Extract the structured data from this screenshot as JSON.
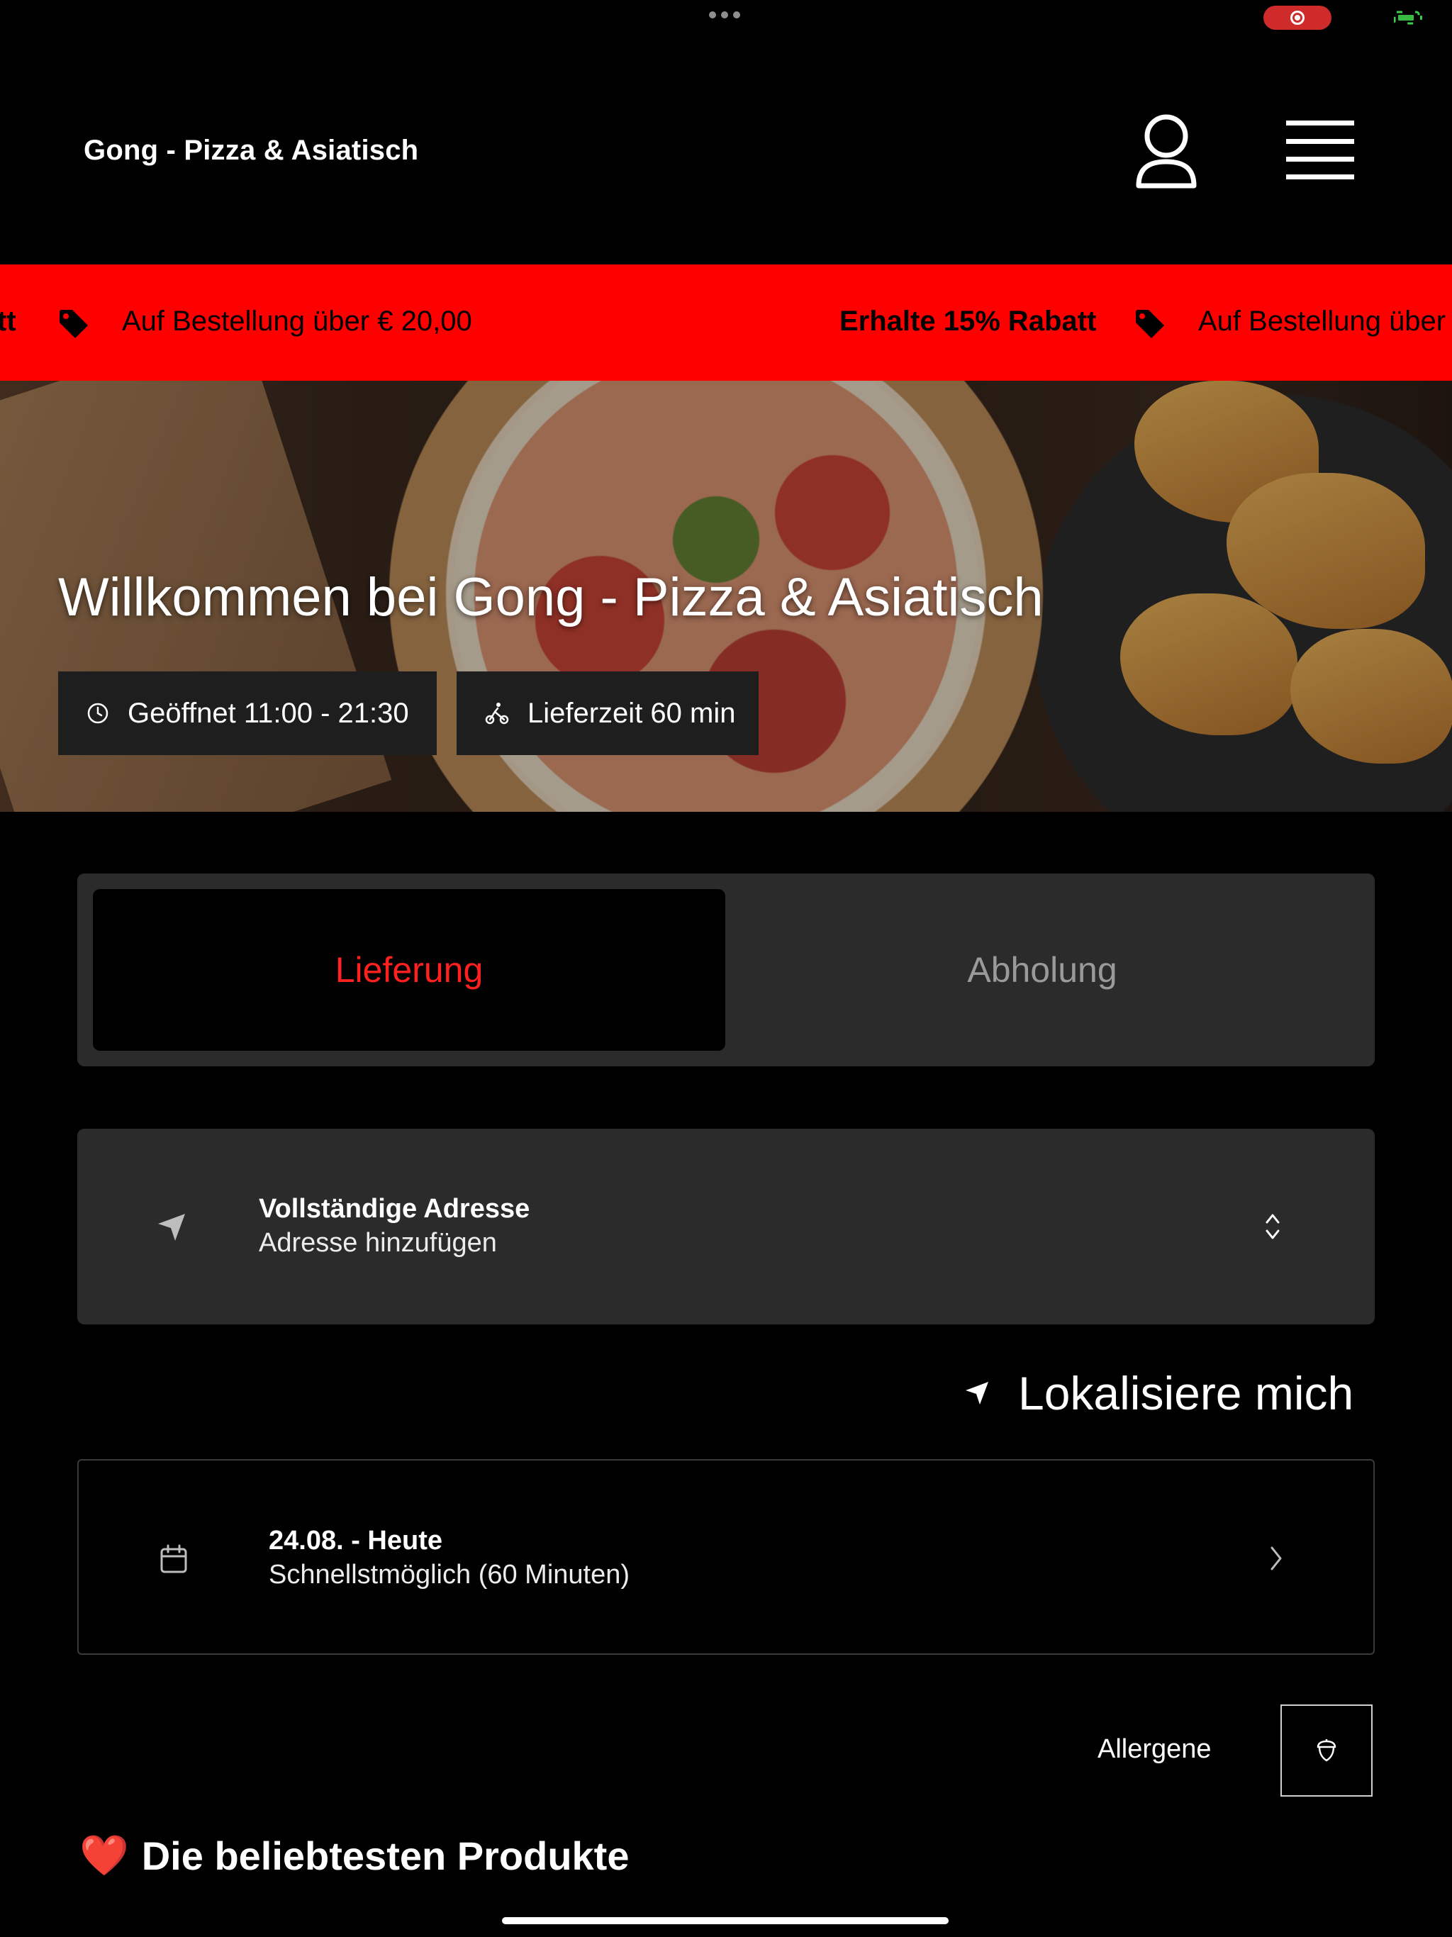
{
  "header": {
    "brand": "Gong - Pizza & Asiatisch"
  },
  "promo": {
    "left_fragment": "tt",
    "offer_1": "Auf Bestellung über € 20,00",
    "discount": "Erhalte 15% Rabatt",
    "offer_2": "Auf Bestellung über"
  },
  "hero": {
    "title": "Willkommen bei Gong - Pizza & Asiatisch",
    "hours": "Geöffnet 11:00 - 21:30",
    "delivery_time": "Lieferzeit 60 min"
  },
  "order_mode": {
    "delivery": "Lieferung",
    "pickup": "Abholung",
    "selected": "Lieferung"
  },
  "address": {
    "title": "Vollständige Adresse",
    "subtitle": "Adresse hinzufügen"
  },
  "locate": {
    "label": "Lokalisiere mich"
  },
  "schedule": {
    "date": "24.08. - Heute",
    "time": "Schnellstmöglich (60 Minuten)"
  },
  "allergens": {
    "label": "Allergene"
  },
  "section": {
    "emoji": "❤️",
    "title": "Die beliebtesten Produkte"
  },
  "colors": {
    "accent": "#ff0000",
    "selected_text": "#ff2020",
    "card_bg": "#2b2b2b"
  }
}
